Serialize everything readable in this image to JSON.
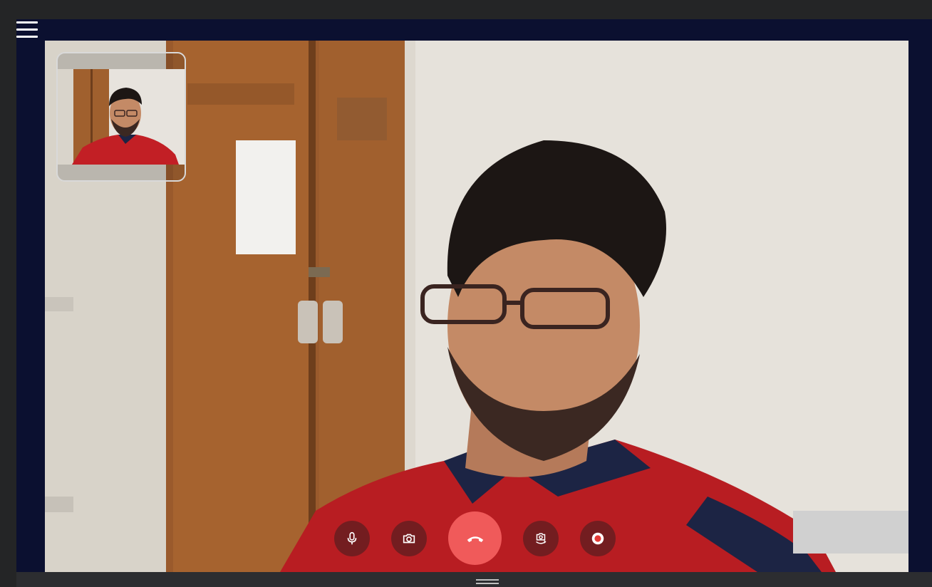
{
  "app": {
    "menu_icon": "hamburger-menu-icon"
  },
  "remote_video": {
    "participant": "remote-participant",
    "scene": "video-feed"
  },
  "self_view": {
    "scene": "local-video-preview"
  },
  "controls": [
    {
      "name": "microphone-button",
      "icon": "microphone-icon"
    },
    {
      "name": "camera-button",
      "icon": "camera-icon"
    },
    {
      "name": "end-call-button",
      "icon": "phone-hangup-icon"
    },
    {
      "name": "switch-camera-button",
      "icon": "switch-camera-icon"
    },
    {
      "name": "record-button",
      "icon": "record-icon"
    }
  ],
  "colors": {
    "end_call": "#f05a5a",
    "call_background": "#0b1030",
    "record_dot": "#e53935",
    "toolbar": "#242526"
  },
  "resize_handle": {
    "icon": "drag-handle-icon"
  }
}
